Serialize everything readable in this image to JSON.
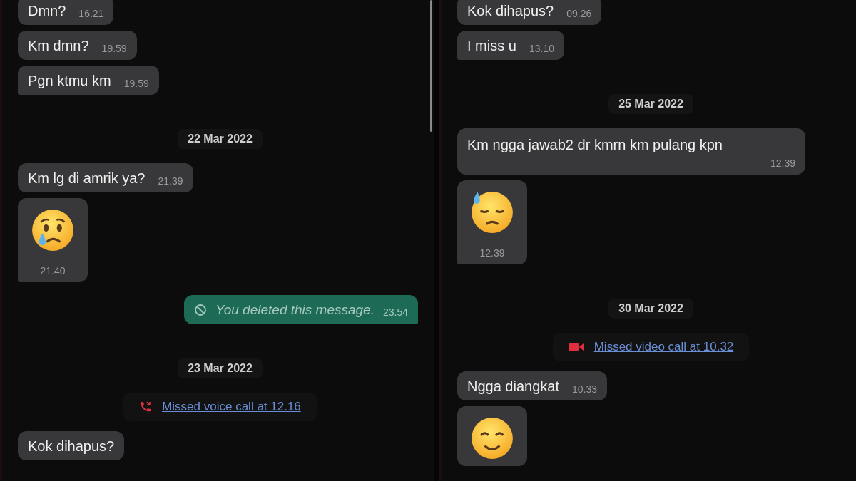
{
  "panels": [
    {
      "scrollbar": true,
      "items": [
        {
          "kind": "text",
          "text": "Dmn?",
          "time": "16.21",
          "tail": false
        },
        {
          "kind": "text",
          "text": "Km dmn?",
          "time": "19.59",
          "tail": false
        },
        {
          "kind": "text",
          "text": "Pgn ktmu km",
          "time": "19.59",
          "tail": true
        },
        {
          "kind": "date",
          "text": "22 Mar 2022"
        },
        {
          "kind": "text",
          "text": "Km lg di amrik ya?",
          "time": "21.39",
          "tail": false
        },
        {
          "kind": "crying",
          "time": "21.40",
          "tail": true
        },
        {
          "kind": "deleted",
          "text": "You deleted this message.",
          "time": "23.54"
        },
        {
          "kind": "date",
          "text": "23 Mar 2022"
        },
        {
          "kind": "voicecall",
          "text": "Missed voice call at 12.16"
        },
        {
          "kind": "text",
          "text": "Kok dihapus?",
          "tail": false
        }
      ]
    },
    {
      "scrollbar": false,
      "items": [
        {
          "kind": "text",
          "text": "Kok dihapus?",
          "time": "09.26",
          "tail": false
        },
        {
          "kind": "text",
          "text": "I miss u",
          "time": "13.10",
          "tail": true
        },
        {
          "kind": "date",
          "text": "25 Mar 2022"
        },
        {
          "kind": "longtext",
          "text": "Km ngga jawab2 dr kmrn km pulang kpn",
          "time": "12.39",
          "tail": false
        },
        {
          "kind": "sweat",
          "time": "12.39",
          "tail": true
        },
        {
          "kind": "date",
          "text": "30 Mar 2022"
        },
        {
          "kind": "videocall",
          "text": "Missed video call at 10.32"
        },
        {
          "kind": "text",
          "text": "Ngga diangkat",
          "time": "10.33",
          "tail": false
        },
        {
          "kind": "face",
          "tail": false
        }
      ]
    }
  ]
}
